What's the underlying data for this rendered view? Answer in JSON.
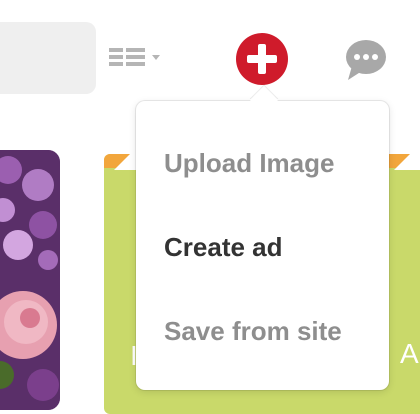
{
  "header": {
    "view_toggle": {
      "icon": "list-view-icon",
      "caret_icon": "caret-down-icon"
    },
    "add_button": {
      "icon": "plus-icon",
      "color": "#cf1b2b"
    },
    "messages_button": {
      "icon": "chat-bubble-icon",
      "color": "#a8a8a8"
    }
  },
  "add_menu": {
    "items": [
      {
        "label": "Upload Image",
        "state": "muted"
      },
      {
        "label": "Create ad",
        "state": "active"
      },
      {
        "label": "Save from site",
        "state": "muted"
      }
    ]
  },
  "colors": {
    "accent_red": "#cf1b2b",
    "muted_text": "#8e8e8e",
    "active_text": "#333333",
    "promo_green": "#c9d96a",
    "promo_orange": "#f2a63c"
  }
}
